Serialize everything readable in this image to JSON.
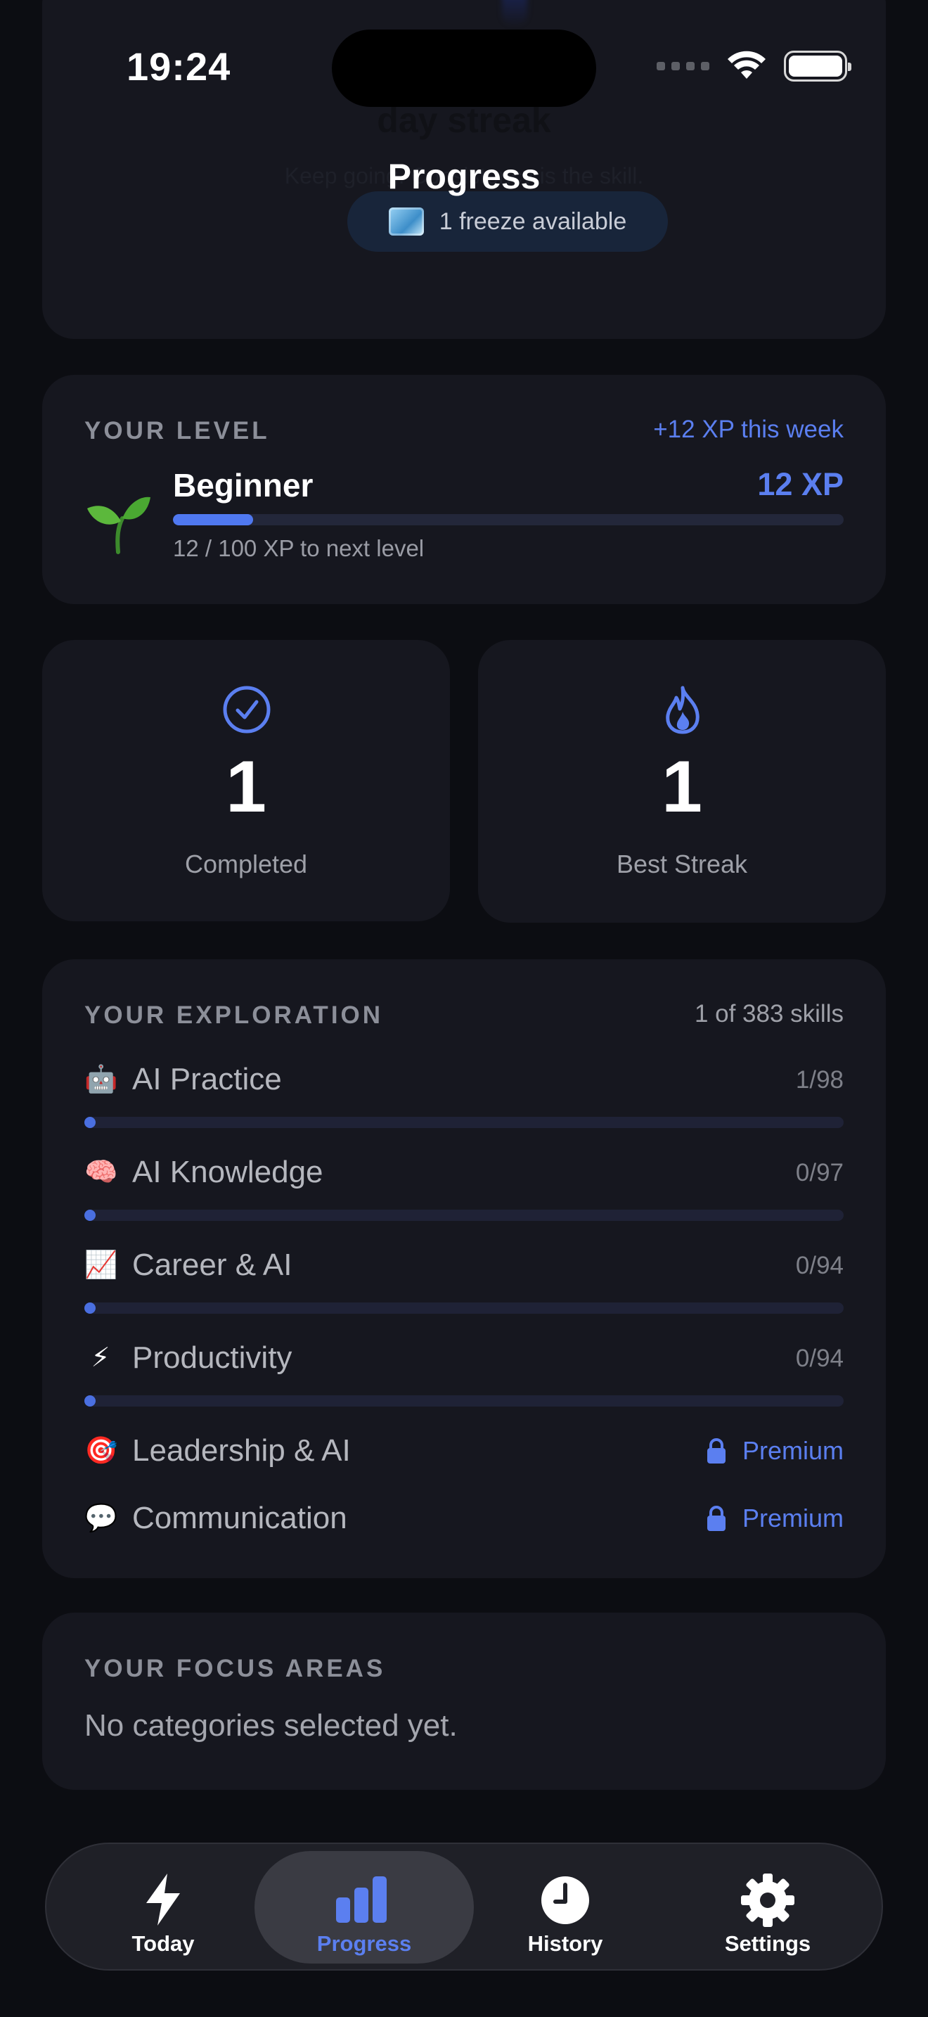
{
  "status_bar": {
    "time": "19:24"
  },
  "header": {
    "title": "Progress"
  },
  "streak": {
    "ghost_title": "day streak",
    "ghost_subtitle": "Keep going. Consistency is the skill.",
    "freeze_label": "1 freeze available"
  },
  "level": {
    "section_label": "YOUR LEVEL",
    "week_gain": "+12 XP this week",
    "name": "Beginner",
    "xp_total": "12 XP",
    "progress_fraction": 0.12,
    "next_level_text": "12 / 100 XP to next level"
  },
  "stats": {
    "completed": {
      "value": "1",
      "label": "Completed",
      "icon": "check-circle-icon"
    },
    "best_streak": {
      "value": "1",
      "label": "Best Streak",
      "icon": "flame-icon"
    }
  },
  "exploration": {
    "section_label": "YOUR EXPLORATION",
    "skills_count": "1 of 383 skills",
    "categories": [
      {
        "emoji": "🤖",
        "name": "AI Practice",
        "count": "1/98",
        "progress": 0.0102
      },
      {
        "emoji": "🧠",
        "name": "AI Knowledge",
        "count": "0/97",
        "progress": 0
      },
      {
        "emoji": "📈",
        "name": "Career & AI",
        "count": "0/94",
        "progress": 0
      },
      {
        "emoji": "⚡",
        "name": "Productivity",
        "count": "0/94",
        "progress": 0
      },
      {
        "emoji": "🎯",
        "name": "Leadership & AI",
        "premium_label": "Premium"
      },
      {
        "emoji": "💬",
        "name": "Communication",
        "premium_label": "Premium"
      }
    ]
  },
  "focus": {
    "section_label": "YOUR FOCUS AREAS",
    "empty_text": "No categories selected yet."
  },
  "tabs": [
    {
      "label": "Today",
      "icon": "bolt-icon",
      "active": false
    },
    {
      "label": "Progress",
      "icon": "chart-bars-icon",
      "active": true
    },
    {
      "label": "History",
      "icon": "clock-icon",
      "active": false
    },
    {
      "label": "Settings",
      "icon": "gear-icon",
      "active": false
    }
  ],
  "colors": {
    "accent": "#5b7ff0",
    "card": "#16171f",
    "background": "#0c0d12"
  }
}
